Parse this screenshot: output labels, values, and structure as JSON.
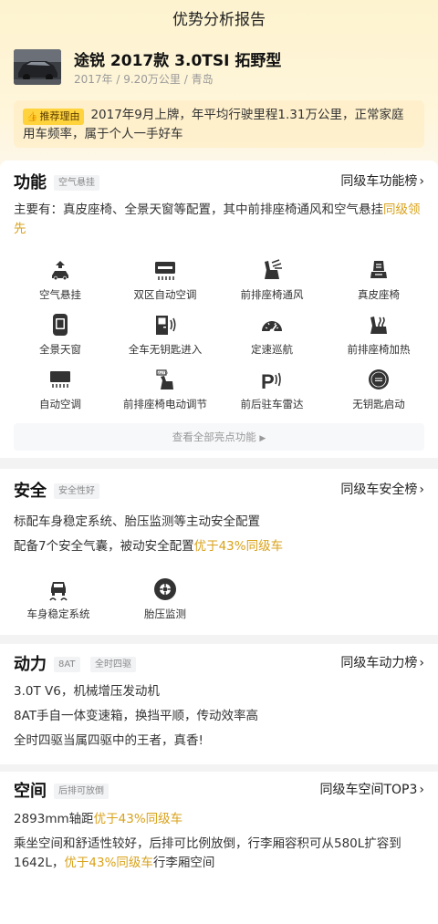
{
  "header": {
    "title": "优势分析报告"
  },
  "car": {
    "title": "途锐 2017款 3.0TSI 拓野型",
    "subtitle": "2017年 / 9.20万公里 / 青岛"
  },
  "reason": {
    "tag": "推荐理由",
    "text": "2017年9月上牌，年平均行驶里程1.31万公里，正常家庭用车频率，属于个人一手好车"
  },
  "function": {
    "title": "功能",
    "chip": "空气悬挂",
    "rank": "同级车功能榜",
    "desc_prefix": "主要有：真皮座椅、全景天窗等配置，其中前排座椅通风和空气悬挂",
    "desc_highlight": "同级领先",
    "features": [
      {
        "label": "空气悬挂",
        "icon": "air-suspension-icon"
      },
      {
        "label": "双区自动空调",
        "icon": "dual-zone-ac-icon"
      },
      {
        "label": "前排座椅通风",
        "icon": "seat-ventilation-icon"
      },
      {
        "label": "真皮座椅",
        "icon": "leather-seat-icon"
      },
      {
        "label": "全景天窗",
        "icon": "panoramic-sunroof-icon"
      },
      {
        "label": "全车无钥匙进入",
        "icon": "keyless-entry-icon"
      },
      {
        "label": "定速巡航",
        "icon": "cruise-control-icon"
      },
      {
        "label": "前排座椅加热",
        "icon": "seat-heating-icon"
      },
      {
        "label": "自动空调",
        "icon": "auto-ac-icon"
      },
      {
        "label": "前排座椅电动调节",
        "icon": "power-seat-icon"
      },
      {
        "label": "前后驻车雷达",
        "icon": "parking-radar-icon"
      },
      {
        "label": "无钥匙启动",
        "icon": "keyless-start-icon"
      }
    ],
    "view_all": "查看全部亮点功能"
  },
  "safety": {
    "title": "安全",
    "chip": "安全性好",
    "rank": "同级车安全榜",
    "line1": "标配车身稳定系统、胎压监测等主动安全配置",
    "line2_prefix": "配备7个安全气囊，被动安全配置",
    "line2_highlight": "优于43%同级车",
    "features": [
      {
        "label": "车身稳定系统",
        "icon": "stability-control-icon"
      },
      {
        "label": "胎压监测",
        "icon": "tire-pressure-icon"
      }
    ]
  },
  "power": {
    "title": "动力",
    "chips": [
      "8AT",
      "全时四驱"
    ],
    "rank": "同级车动力榜",
    "lines": [
      "3.0T V6，机械增压发动机",
      "8AT手自一体变速箱，换挡平顺，传动效率高",
      "全时四驱当属四驱中的王者，真香!"
    ]
  },
  "space": {
    "title": "空间",
    "chip": "后排可放倒",
    "rank": "同级车空间TOP3",
    "line1_prefix": "2893mm轴距",
    "line1_highlight": "优于43%同级车",
    "line2_prefix": "乘坐空间和舒适性较好，后排可比例放倒，行李厢容积可从580L扩容到1642L，",
    "line2_highlight": "优于43%同级车",
    "line2_suffix": "行李厢空间"
  },
  "colors": {
    "accent": "#d9a21b",
    "tag": "#ffd33d",
    "icon": "#333333"
  }
}
